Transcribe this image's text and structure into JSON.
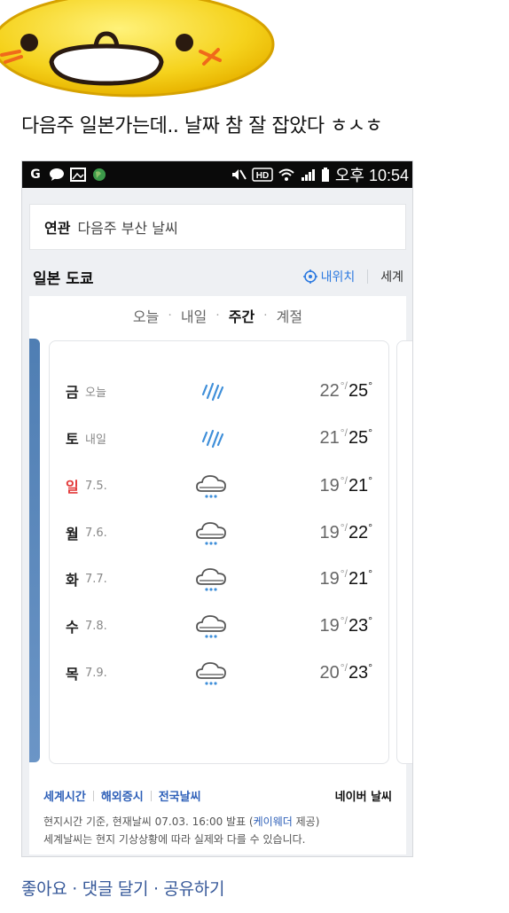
{
  "post": {
    "text": "다음주 일본가는데.. 날짜 참 잘 잡았다 ㅎㅅㅎ"
  },
  "statusbar": {
    "time": "오후 10:54",
    "icons": [
      "g-app-icon",
      "talk-icon",
      "gallery-icon",
      "globe-icon",
      "mute-icon",
      "hd-icon",
      "wifi-icon",
      "signal-icon",
      "battery-icon"
    ]
  },
  "related": {
    "label": "연관",
    "value": "다음주 부산 날씨"
  },
  "location": {
    "title": "일본 도쿄",
    "my_location": "내위치",
    "world": "세계"
  },
  "tabs": [
    "오늘",
    "내일",
    "주간",
    "계절"
  ],
  "active_tab": "주간",
  "forecast": [
    {
      "day": "금",
      "date": "오늘",
      "weather": "rain",
      "low": "22",
      "high": "25",
      "weekend": false
    },
    {
      "day": "토",
      "date": "내일",
      "weather": "rain",
      "low": "21",
      "high": "25",
      "weekend": false
    },
    {
      "day": "일",
      "date": "7.5.",
      "weather": "cloud-rain",
      "low": "19",
      "high": "21",
      "weekend": true
    },
    {
      "day": "월",
      "date": "7.6.",
      "weather": "cloud-rain",
      "low": "19",
      "high": "22",
      "weekend": false
    },
    {
      "day": "화",
      "date": "7.7.",
      "weather": "cloud-rain",
      "low": "19",
      "high": "21",
      "weekend": false
    },
    {
      "day": "수",
      "date": "7.8.",
      "weather": "cloud-rain",
      "low": "19",
      "high": "23",
      "weekend": false
    },
    {
      "day": "목",
      "date": "7.9.",
      "weather": "cloud-rain",
      "low": "20",
      "high": "23",
      "weekend": false
    }
  ],
  "footer": {
    "links": [
      "세계시간",
      "해외증시",
      "전국날씨"
    ],
    "brand": "네이버 날씨",
    "note1_prefix": "현지시간 기준, 현재날씨 07.03. 16:00 발표 (",
    "note1_link": "케이웨더",
    "note1_suffix": " 제공)",
    "note2": "세계날씨는 현지 기상상황에 따라 실제와 다를 수 있습니다."
  },
  "actions": "좋아요 · 댓글 달기 · 공유하기",
  "colors": {
    "accent": "#2d7ae0",
    "link": "#365899",
    "weekend": "#e33a3a"
  }
}
